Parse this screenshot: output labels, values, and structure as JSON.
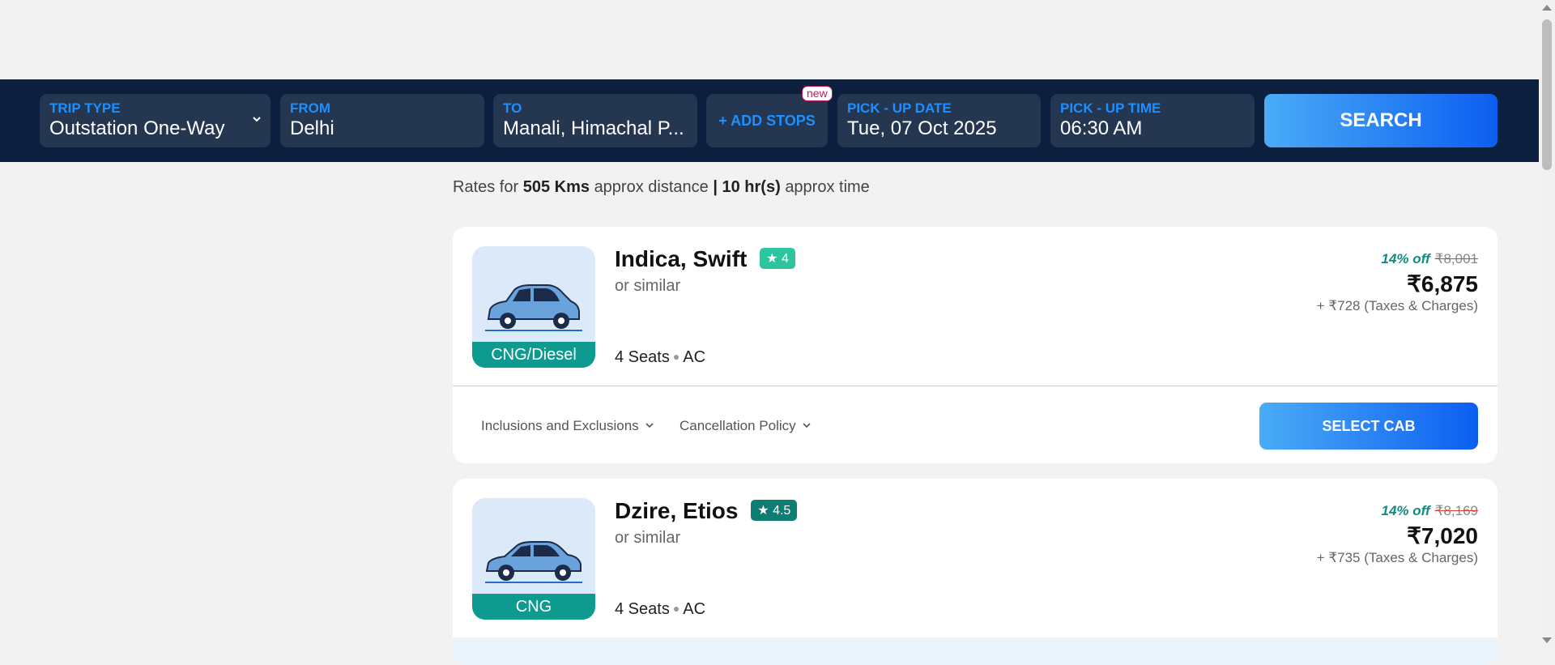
{
  "search": {
    "trip_type": {
      "label": "TRIP TYPE",
      "value": "Outstation One-Way"
    },
    "from": {
      "label": "FROM",
      "value": "Delhi"
    },
    "to": {
      "label": "TO",
      "value": "Manali, Himachal P..."
    },
    "add_stops": "+ ADD STOPS",
    "new_badge": "new",
    "pickup_date": {
      "label": "PICK - UP DATE",
      "value": "Tue, 07 Oct 2025"
    },
    "pickup_time": {
      "label": "PICK - UP TIME",
      "value": "06:30 AM"
    },
    "search_button": "SEARCH"
  },
  "rates": {
    "prefix": "Rates for",
    "distance": "505 Kms",
    "distance_suffix": "approx distance",
    "separator": "|",
    "time": "10 hr(s)",
    "time_suffix": "approx time"
  },
  "cabs": [
    {
      "name": "Indica, Swift",
      "rating": "4",
      "rating_color": "#2ec4a0",
      "similar": "or similar",
      "fuel": "CNG/Diesel",
      "seats": "4 Seats",
      "ac": "AC",
      "discount": "14% off",
      "old_price": "₹8,001",
      "price": "₹6,875",
      "taxes": "+ ₹728 (Taxes & Charges)",
      "inclusions": "Inclusions and Exclusions",
      "cancellation": "Cancellation Policy",
      "select": "SELECT CAB"
    },
    {
      "name": "Dzire, Etios",
      "rating": "4.5",
      "rating_color": "#0e7d72",
      "similar": "or similar",
      "fuel": "CNG",
      "seats": "4 Seats",
      "ac": "AC",
      "discount": "14% off",
      "old_price": "₹8,169",
      "price": "₹7,020",
      "taxes": "+ ₹735 (Taxes & Charges)"
    }
  ],
  "icons": {
    "chevron": "chevron-down-icon",
    "star": "star-icon",
    "car": "car-icon"
  },
  "colors": {
    "header_bg": "#0c1f3f",
    "accent_blue": "#1e8fff",
    "fuel_teal": "#0e9a8f"
  }
}
